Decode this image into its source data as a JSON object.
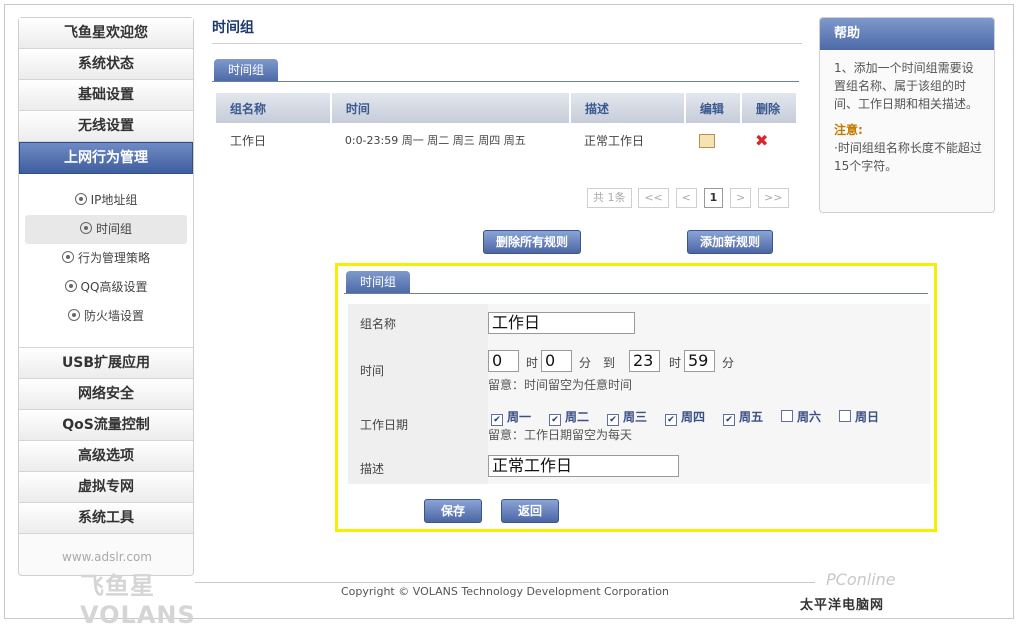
{
  "sidebar": {
    "items": [
      {
        "label": "飞鱼星欢迎您"
      },
      {
        "label": "系统状态"
      },
      {
        "label": "基础设置"
      },
      {
        "label": "无线设置"
      },
      {
        "label": "上网行为管理"
      }
    ],
    "sub_items": [
      {
        "label": "IP地址组"
      },
      {
        "label": "时间组"
      },
      {
        "label": "行为管理策略"
      },
      {
        "label": "QQ高级设置"
      },
      {
        "label": "防火墙设置"
      }
    ],
    "more_items": [
      {
        "label": "USB扩展应用"
      },
      {
        "label": "网络安全"
      },
      {
        "label": "QoS流量控制"
      },
      {
        "label": "高级选项"
      },
      {
        "label": "虚拟专网"
      },
      {
        "label": "系统工具"
      }
    ],
    "logo_url": "www.adslr.com",
    "logo_brand": "飞鱼星 VOLANS"
  },
  "page": {
    "title": "时间组",
    "tab": "时间组"
  },
  "table": {
    "headers": [
      "组名称",
      "时间",
      "描述",
      "编辑",
      "删除"
    ],
    "rows": [
      {
        "name": "工作日",
        "time": "0:0-23:59 周一  周二  周三  周四  周五",
        "desc": "正常工作日"
      }
    ]
  },
  "pager": {
    "total": "共 1条",
    "first": "<<",
    "prev": "<",
    "current": "1",
    "next": ">",
    "last": ">>"
  },
  "buttons": {
    "delete_all": "删除所有规则",
    "add_new": "添加新规则",
    "save": "保存",
    "back": "返回"
  },
  "form": {
    "tab": "时间组",
    "name_label": "组名称",
    "name_value": "工作日",
    "time_label": "时间",
    "start_hour": "0",
    "start_min": "0",
    "end_hour": "23",
    "end_min": "59",
    "unit_hour": "时",
    "unit_min": "分",
    "unit_to": "到",
    "time_note": "留意：时间留空为任意时间",
    "days_label": "工作日期",
    "days": [
      {
        "label": "周一",
        "checked": true
      },
      {
        "label": "周二",
        "checked": true
      },
      {
        "label": "周三",
        "checked": true
      },
      {
        "label": "周四",
        "checked": true
      },
      {
        "label": "周五",
        "checked": true
      },
      {
        "label": "周六",
        "checked": false
      },
      {
        "label": "周日",
        "checked": false
      }
    ],
    "days_note": "留意：工作日期留空为每天",
    "desc_label": "描述",
    "desc_value": "正常工作日"
  },
  "help": {
    "title": "帮助",
    "body": "1、添加一个时间组需要设置组名称、属于该组的时间、工作日期和相关描述。",
    "note_title": "注意:",
    "note_body": "·时间组组名称长度不能超过15个字符。"
  },
  "footer": {
    "copyright": "Copyright © VOLANS Technology Development Corporation"
  },
  "watermark": {
    "line1": "PConline",
    "line2": "太平洋电脑网"
  },
  "colors": {
    "accent": "#4d6aa8",
    "highlight_border": "#f4f000",
    "delete_red": "#d8262a"
  }
}
